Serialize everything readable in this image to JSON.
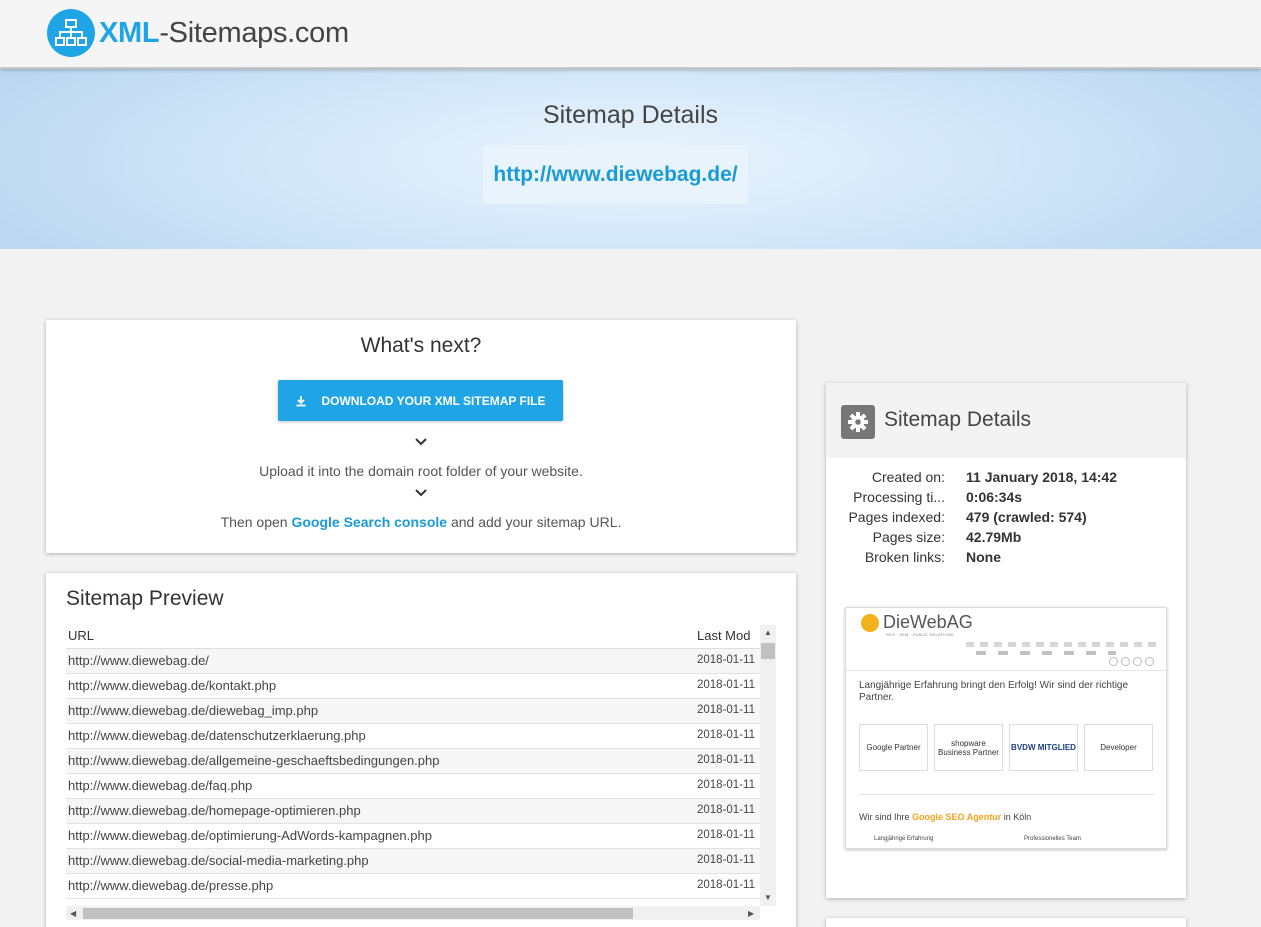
{
  "header": {
    "logo_xml": "XML",
    "logo_rest": "-Sitemaps.com",
    "logo_icon": "sitemap-icon"
  },
  "hero": {
    "title": "Sitemap Details",
    "url": "http://www.diewebag.de/"
  },
  "whats_next": {
    "title": "What's next?",
    "download_label": "DOWNLOAD YOUR XML SITEMAP FILE",
    "download_icon": "download-icon",
    "step1": "Upload it into the domain root folder of your website.",
    "step2_prefix": "Then open ",
    "step2_link": "Google Search console",
    "step2_suffix": " and add your sitemap URL."
  },
  "preview": {
    "title": "Sitemap Preview",
    "columns": [
      "URL",
      "Last Mod"
    ],
    "rows": [
      {
        "url": "http://www.diewebag.de/",
        "mod": "2018-01-11"
      },
      {
        "url": "http://www.diewebag.de/kontakt.php",
        "mod": "2018-01-11"
      },
      {
        "url": "http://www.diewebag.de/diewebag_imp.php",
        "mod": "2018-01-11"
      },
      {
        "url": "http://www.diewebag.de/datenschutzerklaerung.php",
        "mod": "2018-01-11"
      },
      {
        "url": "http://www.diewebag.de/allgemeine-geschaeftsbedingungen.php",
        "mod": "2018-01-11"
      },
      {
        "url": "http://www.diewebag.de/faq.php",
        "mod": "2018-01-11"
      },
      {
        "url": "http://www.diewebag.de/homepage-optimieren.php",
        "mod": "2018-01-11"
      },
      {
        "url": "http://www.diewebag.de/optimierung-AdWords-kampagnen.php",
        "mod": "2018-01-11"
      },
      {
        "url": "http://www.diewebag.de/social-media-marketing.php",
        "mod": "2018-01-11"
      },
      {
        "url": "http://www.diewebag.de/presse.php",
        "mod": "2018-01-11"
      }
    ]
  },
  "details": {
    "title": "Sitemap Details",
    "icon": "gear-icon",
    "items": [
      {
        "label": "Created on:",
        "value": "11 January 2018, 14:42"
      },
      {
        "label": "Processing ti...",
        "value": "0:06:34s"
      },
      {
        "label": "Pages indexed:",
        "value": "479 (crawled: 574)"
      },
      {
        "label": "Pages size:",
        "value": "42.79Mb"
      },
      {
        "label": "Broken links:",
        "value": "None"
      }
    ]
  },
  "site_thumbnail": {
    "brand": "DieWebAG",
    "subtitle": "SEO · SEM · PUBLIC RELATIONS",
    "tagline": "Langjährige Erfahrung bringt den Erfolg! Wir sind der richtige Partner.",
    "badges": [
      "Google Partner",
      "shopware Business Partner",
      "BVDW MITGLIED",
      "Developer"
    ],
    "seo_prefix": "Wir sind Ihre ",
    "seo_highlight": "Google SEO Agentur",
    "seo_suffix": " in Köln",
    "features": [
      "Langjährige Erfahrung",
      "Professionelles Team"
    ]
  },
  "colors": {
    "accent": "#1fa5e6",
    "link": "#1a9bd9",
    "thumbnail_accent": "#f3a21b"
  }
}
